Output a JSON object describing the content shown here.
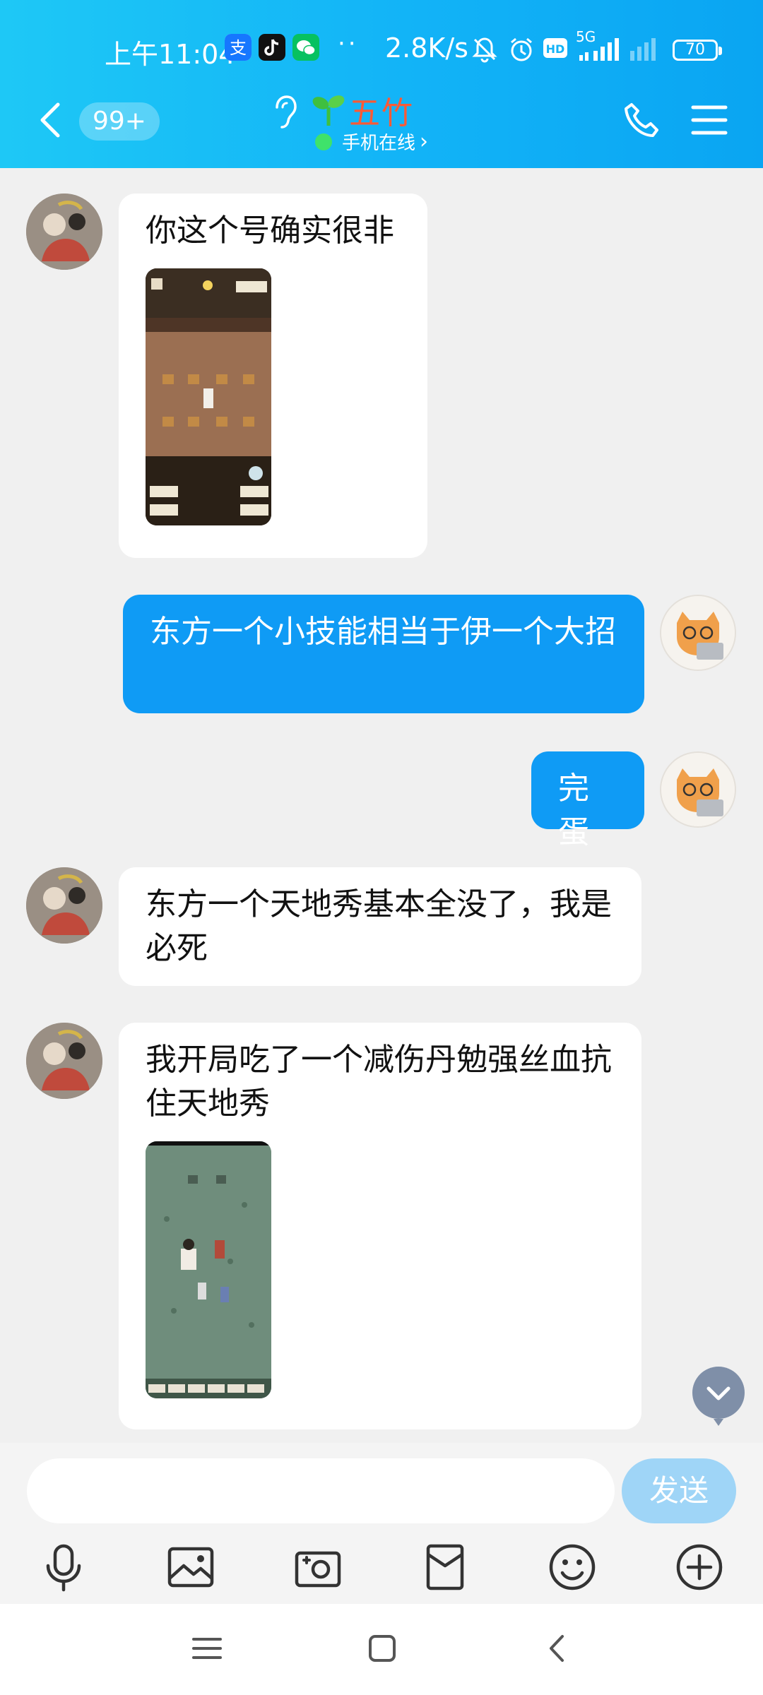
{
  "status_bar": {
    "time": "上午11:04",
    "net_speed": "2.8K/s",
    "network": "5G",
    "battery": "70",
    "more": "··",
    "hd": "HD",
    "icons": [
      "alipay-icon",
      "tiktok-icon",
      "wechat-icon",
      "mute-bell-icon",
      "alarm-icon",
      "hd-icon",
      "signal-icon",
      "battery-icon"
    ]
  },
  "header": {
    "unread_count": "99+",
    "contact_name": "五竹",
    "online_status": "手机在线",
    "online_chevron": "›",
    "colors": {
      "name": "#ff5a36",
      "online_dot": "#3fe26a",
      "bar": "#12b3f7"
    }
  },
  "messages": [
    {
      "side": "in",
      "text": "你这个号确实很非",
      "image": "game-screenshot-classroom"
    },
    {
      "side": "out",
      "text": "东方一个小技能相当于伊一个大招"
    },
    {
      "side": "out",
      "text": "完蛋"
    },
    {
      "side": "in",
      "text": "东方一个天地秀基本全没了，我是必死"
    },
    {
      "side": "in",
      "text": "我开局吃了一个减伤丹勉强丝血抗住天地秀",
      "image": "game-screenshot-field"
    }
  ],
  "input": {
    "value": "",
    "placeholder": ""
  },
  "send_label": "发送",
  "toolbar": [
    "voice-icon",
    "photo-icon",
    "camera-icon",
    "red-packet-icon",
    "emoji-icon",
    "plus-icon"
  ],
  "colors": {
    "bubble_out": "#0f9bf5",
    "bubble_in": "#ffffff",
    "send_disabled": "#9fd5f7"
  }
}
